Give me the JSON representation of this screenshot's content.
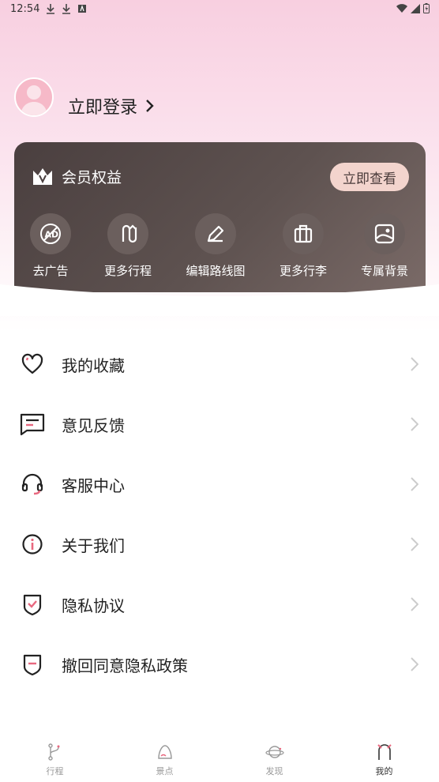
{
  "status_bar": {
    "time": "12:54"
  },
  "profile": {
    "login_label": "立即登录"
  },
  "vip": {
    "title": "会员权益",
    "view_button": "立即查看",
    "benefits": [
      {
        "label": "去广告",
        "icon": "no-ads-icon"
      },
      {
        "label": "更多行程",
        "icon": "route-icon"
      },
      {
        "label": "编辑路线图",
        "icon": "pencil-icon"
      },
      {
        "label": "更多行李",
        "icon": "luggage-icon"
      },
      {
        "label": "专属背景",
        "icon": "image-icon"
      }
    ]
  },
  "menu": [
    {
      "label": "我的收藏",
      "icon": "heart-icon"
    },
    {
      "label": "意见反馈",
      "icon": "feedback-icon"
    },
    {
      "label": "客服中心",
      "icon": "headset-icon"
    },
    {
      "label": "关于我们",
      "icon": "info-icon"
    },
    {
      "label": "隐私协议",
      "icon": "shield-check-icon"
    },
    {
      "label": "撤回同意隐私政策",
      "icon": "shield-minus-icon"
    }
  ],
  "tabbar": [
    {
      "label": "行程",
      "icon": "route-tab-icon"
    },
    {
      "label": "景点",
      "icon": "mountain-tab-icon"
    },
    {
      "label": "发现",
      "icon": "planet-tab-icon"
    },
    {
      "label": "我的",
      "icon": "cat-tab-icon",
      "active": true
    }
  ],
  "colors": {
    "accent": "#e8687f",
    "card": "#4a3f3f",
    "button": "#f3d4cd"
  }
}
